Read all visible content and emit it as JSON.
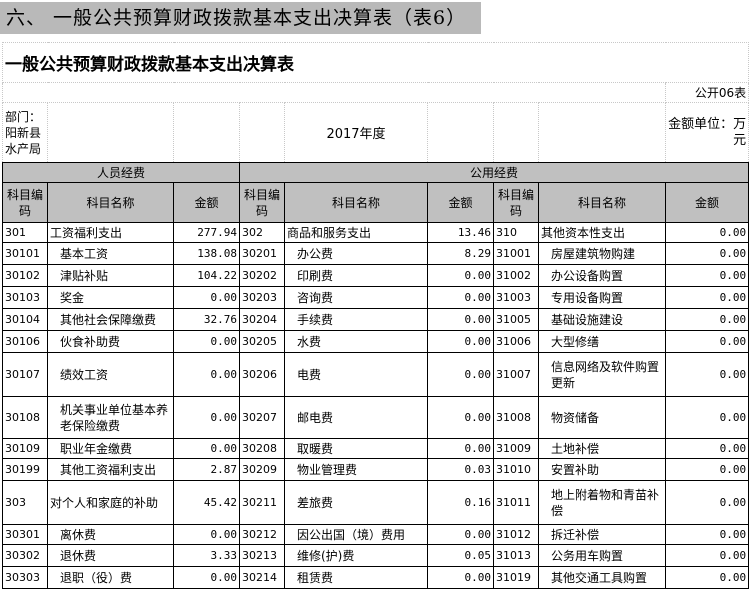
{
  "section_heading": "六、 一般公共预算财政拨款基本支出决算表（表6）",
  "table_title": "一般公共预算财政拨款基本支出决算表",
  "form_no": "公开06表",
  "department": "部门：阳新县水产局",
  "year": "2017年度",
  "unit": "金额单位：万元",
  "group_personnel": "人员经费",
  "group_public": "公用经费",
  "col_code": "科目编码",
  "col_name": "科目名称",
  "col_amount": "金额",
  "rows": [
    {
      "c1": "301",
      "n1": "工资福利支出",
      "a1": "277.94",
      "c2": "302",
      "n2": "商品和服务支出",
      "a2": "13.46",
      "c3": "310",
      "n3": "其他资本性支出",
      "a3": "0.00"
    },
    {
      "c1": "30101",
      "n1": "基本工资",
      "a1": "138.08",
      "c2": "30201",
      "n2": "办公费",
      "a2": "8.29",
      "c3": "31001",
      "n3": "房屋建筑物购建",
      "a3": "0.00"
    },
    {
      "c1": "30102",
      "n1": "津贴补贴",
      "a1": "104.22",
      "c2": "30202",
      "n2": "印刷费",
      "a2": "0.00",
      "c3": "31002",
      "n3": "办公设备购置",
      "a3": "0.00"
    },
    {
      "c1": "30103",
      "n1": "奖金",
      "a1": "0.00",
      "c2": "30203",
      "n2": "咨询费",
      "a2": "0.00",
      "c3": "31003",
      "n3": "专用设备购置",
      "a3": "0.00"
    },
    {
      "c1": "30104",
      "n1": "其他社会保障缴费",
      "a1": "32.76",
      "c2": "30204",
      "n2": "手续费",
      "a2": "0.00",
      "c3": "31005",
      "n3": "基础设施建设",
      "a3": "0.00"
    },
    {
      "c1": "30106",
      "n1": "伙食补助费",
      "a1": "0.00",
      "c2": "30205",
      "n2": "水费",
      "a2": "0.00",
      "c3": "31006",
      "n3": "大型修缮",
      "a3": "0.00"
    },
    {
      "c1": "30107",
      "n1": "绩效工资",
      "a1": "0.00",
      "c2": "30206",
      "n2": "电费",
      "a2": "0.00",
      "c3": "31007",
      "n3": "信息网络及软件购置更新",
      "a3": "0.00"
    },
    {
      "c1": "30108",
      "n1": "机关事业单位基本养老保险缴费",
      "a1": "0.00",
      "c2": "30207",
      "n2": "邮电费",
      "a2": "0.00",
      "c3": "31008",
      "n3": "物资储备",
      "a3": "0.00"
    },
    {
      "c1": "30109",
      "n1": "职业年金缴费",
      "a1": "0.00",
      "c2": "30208",
      "n2": "取暖费",
      "a2": "0.00",
      "c3": "31009",
      "n3": "土地补偿",
      "a3": "0.00"
    },
    {
      "c1": "30199",
      "n1": "其他工资福利支出",
      "a1": "2.87",
      "c2": "30209",
      "n2": "物业管理费",
      "a2": "0.03",
      "c3": "31010",
      "n3": "安置补助",
      "a3": "0.00"
    },
    {
      "c1": "303",
      "n1": "对个人和家庭的补助",
      "a1": "45.42",
      "c2": "30211",
      "n2": "差旅费",
      "a2": "0.16",
      "c3": "31011",
      "n3": "地上附着物和青苗补偿",
      "a3": "0.00"
    },
    {
      "c1": "30301",
      "n1": "离休费",
      "a1": "0.00",
      "c2": "30212",
      "n2": "因公出国（境）费用",
      "a2": "0.00",
      "c3": "31012",
      "n3": "拆迁补偿",
      "a3": "0.00"
    },
    {
      "c1": "30302",
      "n1": "退休费",
      "a1": "3.33",
      "c2": "30213",
      "n2": "维修(护)费",
      "a2": "0.05",
      "c3": "31013",
      "n3": "公务用车购置",
      "a3": "0.00"
    },
    {
      "c1": "30303",
      "n1": "退职（役）费",
      "a1": "0.00",
      "c2": "30214",
      "n2": "租赁费",
      "a2": "0.00",
      "c3": "31019",
      "n3": "其他交通工具购置",
      "a3": "0.00"
    }
  ]
}
